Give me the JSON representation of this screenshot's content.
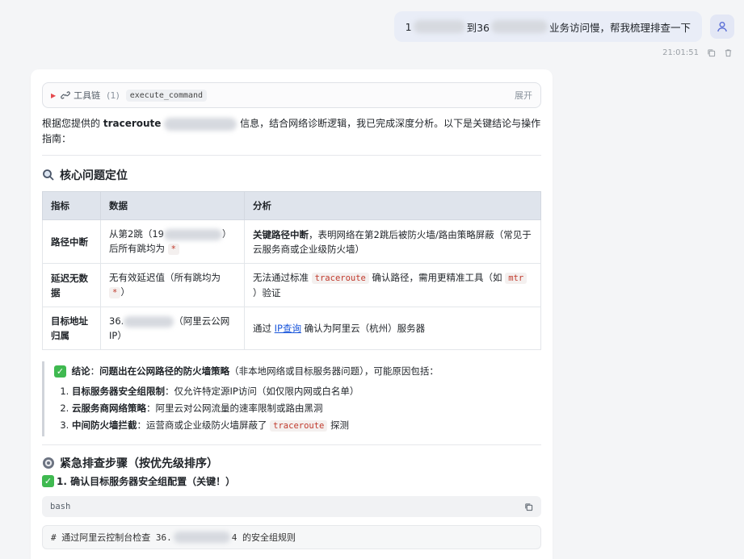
{
  "user": {
    "message_prefix": "1",
    "message_mid": "到36",
    "message_suffix": "业务访问慢，帮我梳理排查一下",
    "time": "21:01:51"
  },
  "toolchain": {
    "label": "工具链",
    "count": "(1)",
    "chip": "execute_command",
    "expand": "展开"
  },
  "intro": {
    "p1": "根据您提供的",
    "p2": "traceroute",
    "p3": "信息，结合网络诊断逻辑，我已完成深度分析。以下是关键结论与操作指南："
  },
  "section1": {
    "title": "核心问题定位"
  },
  "table": {
    "headers": [
      "指标",
      "数据",
      "分析"
    ],
    "rows": [
      {
        "k": "路径中断",
        "d_a": "从第2跳（19",
        "d_b": "）后所有跳均为",
        "d_code": "*",
        "a_bold": "关键路径中断",
        "a_rest": "，表明网络在第2跳后被防火墙/路由策略屏蔽（常见于云服务商或企业级防火墙）"
      },
      {
        "k": "延迟无数据",
        "d_a": "无有效延迟值（所有跳均为",
        "d_code": "*",
        "d_b": "）",
        "a1": "无法通过标准",
        "a_code1": "traceroute",
        "a2": "确认路径，需用更精准工具（如",
        "a_code2": "mtr",
        "a3": "）验证"
      },
      {
        "k": "目标地址归属",
        "d_a": "36.",
        "d_b": "（阿里云公网IP）",
        "a1": "通过",
        "a_link": "IP查询",
        "a2": "确认为阿里云（杭州）服务器"
      }
    ]
  },
  "conclusion": {
    "label": "结论",
    "bold": "问题出在公网路径的防火墙策略",
    "rest": "（非本地网络或目标服务器问题），可能原因包括：",
    "items": [
      {
        "bold": "目标服务器安全组限制",
        "rest": "：仅允许特定源IP访问（如仅限内网或白名单）"
      },
      {
        "bold": "云服务商网络策略",
        "rest": "：阿里云对公网流量的速率限制或路由黑洞"
      },
      {
        "bold": "中间防火墙拦截",
        "rest_a": "：运营商或企业级防火墙屏蔽了",
        "code": "traceroute",
        "rest_b": "探测"
      }
    ]
  },
  "section2": {
    "title": "紧急排查步骤（按优先级排序）"
  },
  "step1": {
    "title": "1. 确认目标服务器安全组配置（关键！）"
  },
  "codeblock": {
    "lang": "bash",
    "line_a": "#  通过阿里云控制台检查 36.",
    "line_b": "4  的安全组规则"
  },
  "colors": {
    "accent": "#1a56db",
    "check": "#3fb950",
    "code_red": "#c0392b"
  }
}
